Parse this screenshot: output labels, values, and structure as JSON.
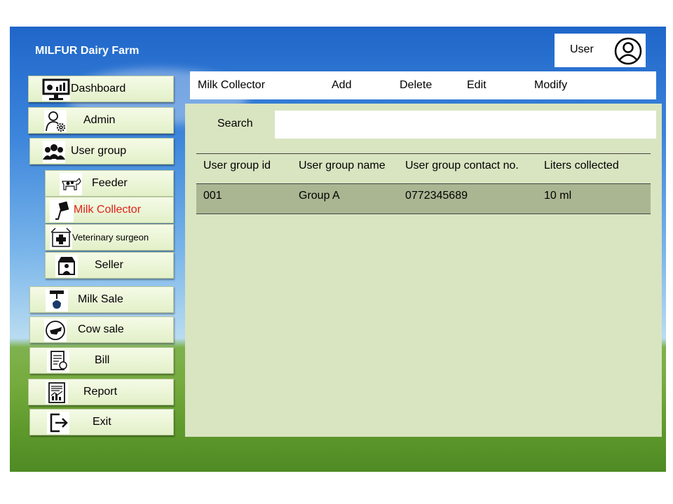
{
  "app": {
    "title": "MILFUR Dairy Farm",
    "user_label": "User"
  },
  "sidebar": {
    "items": [
      {
        "label": "Dashboard",
        "icon": "dashboard-icon"
      },
      {
        "label": "Admin",
        "icon": "admin-gear-icon"
      },
      {
        "label": "User group",
        "icon": "user-group-icon"
      },
      {
        "label": "Feeder",
        "icon": "cow-icon"
      },
      {
        "label": "Milk Collector",
        "icon": "milk-collector-icon"
      },
      {
        "label": "Veterinary surgeon",
        "icon": "veterinary-icon"
      },
      {
        "label": "Seller",
        "icon": "seller-shop-icon"
      },
      {
        "label": "Milk Sale",
        "icon": "milk-sale-icon"
      },
      {
        "label": "Cow sale",
        "icon": "cow-sale-icon"
      },
      {
        "label": "Bill",
        "icon": "bill-icon"
      },
      {
        "label": "Report",
        "icon": "report-icon"
      },
      {
        "label": "Exit",
        "icon": "exit-icon"
      }
    ],
    "active": "Milk Collector"
  },
  "toolbar": {
    "section": "Milk Collector",
    "add": "Add",
    "delete": "Delete",
    "edit": "Edit",
    "modify": "Modify"
  },
  "search": {
    "label": "Search",
    "value": ""
  },
  "table": {
    "columns": [
      "User group id",
      "User group name",
      "User group contact no.",
      "Liters collected"
    ],
    "rows": [
      [
        "001",
        "Group A",
        "0772345689",
        "10 ml"
      ]
    ]
  },
  "colors": {
    "active_text": "#e0211a",
    "content_bg": "#d9e4c1",
    "row_highlight": "#aab592"
  }
}
